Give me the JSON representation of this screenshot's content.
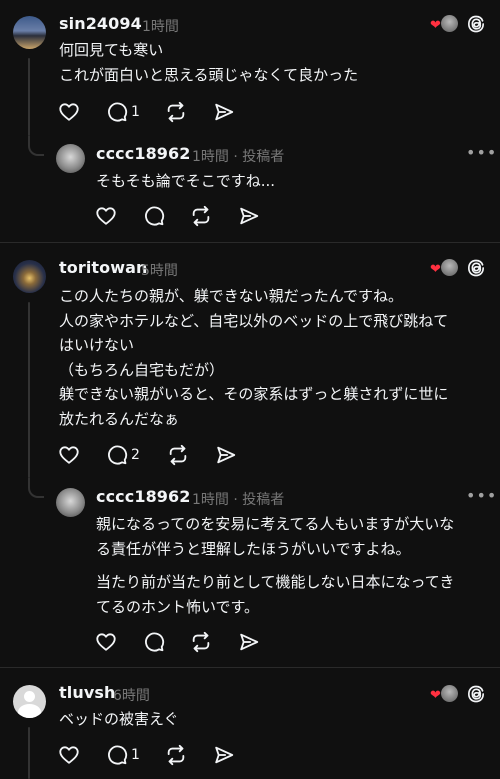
{
  "comments": [
    {
      "username": "sin24094",
      "time": "1時間",
      "lines": [
        "何回見ても寒い",
        "これが面白いと思える頭じゃなくて良かった"
      ],
      "reply_count": "1"
    },
    {
      "username": "cccc18962",
      "time": "1時間",
      "author_tag": "· 投稿者",
      "lines": [
        "そもそも論でそこですね..."
      ]
    },
    {
      "username": "toritowan",
      "time": "5時間",
      "lines": [
        "この人たちの親が、躾できない親だったんですね。",
        "人の家やホテルなど、自宅以外のベッドの上で飛び跳ねて",
        "はいけない",
        "（もちろん自宅もだが）",
        "躾できない親がいると、その家系はずっと躾されずに世に",
        "放たれるんだなぁ"
      ],
      "reply_count": "2"
    },
    {
      "username": "cccc18962",
      "time": "1時間",
      "author_tag": "· 投稿者",
      "paragraph1": [
        "親になるってのを安易に考えてる人もいますが大いな",
        "る責任が伴うと理解したほうがいいですよね。"
      ],
      "paragraph2": [
        "当たり前が当たり前として機能しない日本になってき",
        "てるのホント怖いです。"
      ]
    },
    {
      "username": "tluvsh",
      "time": "6時間",
      "lines": [
        "ベッドの被害えぐ"
      ],
      "reply_count": "1"
    }
  ],
  "icons": {
    "like": "heart-outline-icon",
    "reply": "speech-bubble-icon",
    "repost": "repost-arrows-icon",
    "share": "paper-plane-icon",
    "liked_by_author": "red-heart-avatar-badge-icon",
    "threads_logo": "threads-logo-icon",
    "more": "more-dots-icon"
  },
  "colors": {
    "background": "#101010",
    "text": "#f3f5f7",
    "muted": "#777777",
    "heart": "#ff3040",
    "line": "#333333"
  }
}
